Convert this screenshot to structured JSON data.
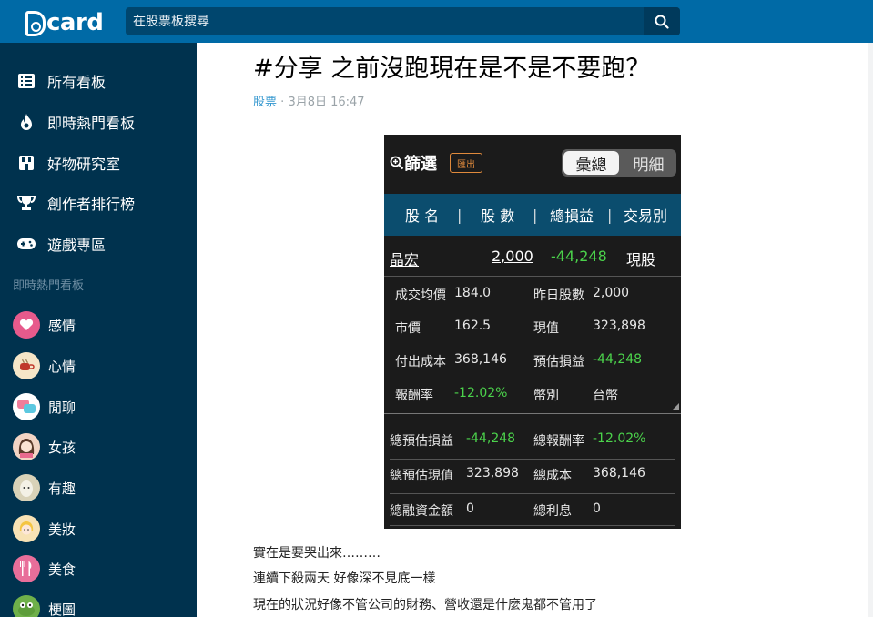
{
  "topbar": {
    "logo_text": "card",
    "search_placeholder": "在股票板搜尋"
  },
  "sidebar": {
    "nav": [
      {
        "label": "所有看板",
        "icon": "list-icon"
      },
      {
        "label": "即時熱門看板",
        "icon": "fire-icon"
      },
      {
        "label": "好物研究室",
        "icon": "store-icon"
      },
      {
        "label": "創作者排行榜",
        "icon": "trophy-icon"
      },
      {
        "label": "遊戲專區",
        "icon": "gamepad-icon"
      }
    ],
    "section_title": "即時熱門看板",
    "boards": [
      {
        "label": "感情",
        "color": "#e75a8c"
      },
      {
        "label": "心情",
        "color": "#f5e6c8"
      },
      {
        "label": "閒聊",
        "color": "#7fd3e6"
      },
      {
        "label": "女孩",
        "color": "#f2d4c4"
      },
      {
        "label": "有趣",
        "color": "#d9d2b8"
      },
      {
        "label": "美妝",
        "color": "#f7e2b5"
      },
      {
        "label": "美食",
        "color": "#e86e9a"
      },
      {
        "label": "梗圖",
        "color": "#6fb04a"
      }
    ]
  },
  "post": {
    "title": "#分享 之前沒跑現在是不是不要跑？",
    "board": "股票",
    "separator": "·",
    "time": "3月8日 16:47",
    "body": [
      "實在是要哭出來………",
      "連續下殺兩天 好像深不見底一樣",
      "現在的狀況好像不管公司的財務、營收還是什麼鬼都不管用了"
    ]
  },
  "screenshot": {
    "filter_label": "篩選",
    "export_label": "匯出",
    "toggle_on": "彙總",
    "toggle_off": "明細",
    "headers": [
      "股 名",
      "股 數",
      "總損益",
      "交易別"
    ],
    "header_sep": "|",
    "stock": {
      "name": "晶宏",
      "shares": "2,000",
      "pnl": "-44,248",
      "type": "現股"
    },
    "details": [
      {
        "l1": "成交均價",
        "v1": "184.0",
        "l2": "昨日股數",
        "v2": "2,000",
        "g1": false,
        "g2": false
      },
      {
        "l1": "市價",
        "v1": "162.5",
        "l2": "現值",
        "v2": "323,898",
        "g1": false,
        "g2": false
      },
      {
        "l1": "付出成本",
        "v1": "368,146",
        "l2": "預估損益",
        "v2": "-44,248",
        "g1": false,
        "g2": true
      },
      {
        "l1": "報酬率",
        "v1": "-12.02%",
        "l2": "幣別",
        "v2": "台幣",
        "g1": true,
        "g2": false
      }
    ],
    "totals": [
      {
        "l1": "總預估損益",
        "v1": "-44,248",
        "l2": "總報酬率",
        "v2": "-12.02%",
        "g1": true,
        "g2": true
      },
      {
        "l1": "總預估現值",
        "v1": "323,898",
        "l2": "總成本",
        "v2": "368,146",
        "g1": false,
        "g2": false
      },
      {
        "l1": "總融資金額",
        "v1": "0",
        "l2": "總利息",
        "v2": "0",
        "g1": false,
        "g2": false
      }
    ],
    "colors": {
      "green": "#4bd24b",
      "header_bg": "#0b4d6e",
      "export": "#e08a3c"
    }
  }
}
